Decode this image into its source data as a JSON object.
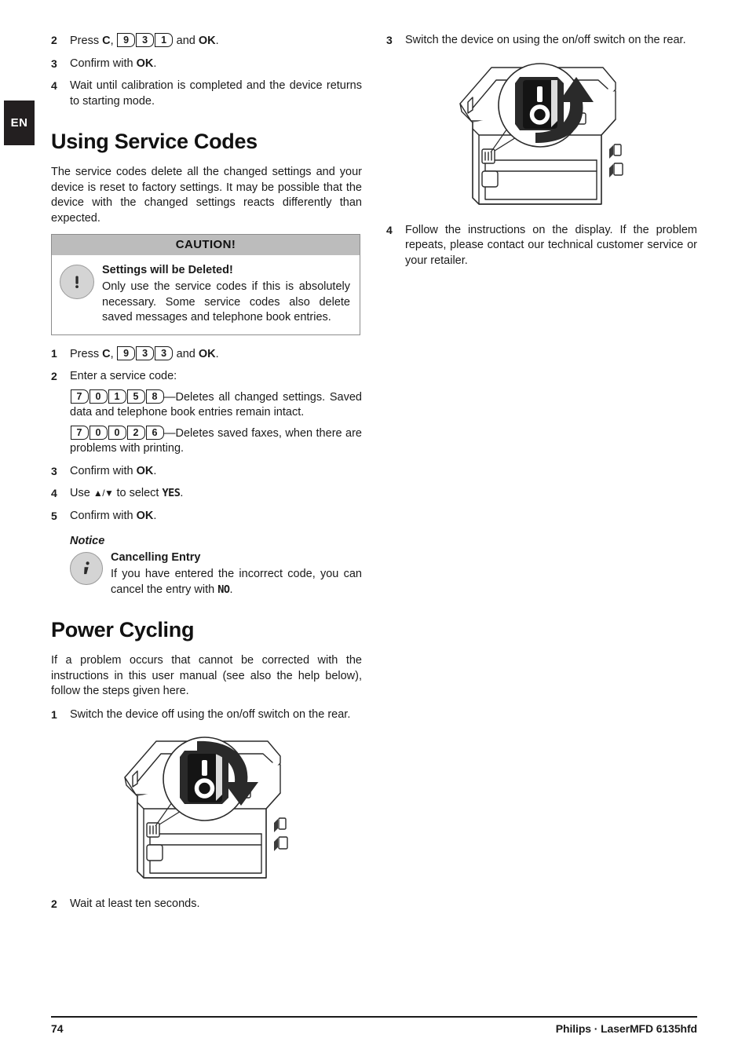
{
  "page": {
    "language_tab": "EN",
    "footer_page_number": "74",
    "footer_model": "Philips · LaserMFD 6135hfd"
  },
  "left_column": {
    "top_steps": [
      {
        "num": "2",
        "prefix": "Press ",
        "bold1": "C",
        "mid": ", ",
        "keys": [
          "9",
          "3",
          "1"
        ],
        "suffix_pre": " and ",
        "bold2": "OK",
        "suffix_post": "."
      },
      {
        "num": "3",
        "text_pre": "Confirm with ",
        "bold": "OK",
        "text_post": "."
      },
      {
        "num": "4",
        "text": "Wait until calibration is completed and the device returns to starting mode."
      }
    ],
    "service_codes": {
      "title": "Using Service Codes",
      "intro": "The service codes delete all the changed settings and your device is reset to factory settings. It may be possible that the device with the changed settings reacts differently than expected.",
      "caution": {
        "header": "CAUTION!",
        "icon": "exclamation-icon",
        "title": "Settings will be Deleted!",
        "text": "Only use the service codes if this is absolutely necessary. Some service codes also delete saved messages and telephone book entries."
      },
      "steps": [
        {
          "num": "1",
          "prefix": "Press ",
          "bold1": "C",
          "mid": ", ",
          "keys": [
            "9",
            "3",
            "3"
          ],
          "suffix_pre": " and ",
          "bold2": "OK",
          "suffix_post": "."
        },
        {
          "num": "2",
          "text": "Enter a service code:"
        },
        {
          "num": "3",
          "text_pre": "Confirm with ",
          "bold": "OK",
          "text_post": "."
        },
        {
          "num": "4",
          "text_pre": "Use ",
          "arrows": "▲/▼",
          "text_mid": " to select ",
          "lcd": "YES",
          "text_post": "."
        },
        {
          "num": "5",
          "text_pre": "Confirm with ",
          "bold": "OK",
          "text_post": "."
        }
      ],
      "code_entries": [
        {
          "keys": [
            "7",
            "0",
            "1",
            "5",
            "8"
          ],
          "description": "—Deletes all changed settings. Saved data and telephone book entries remain intact."
        },
        {
          "keys": [
            "7",
            "0",
            "0",
            "2",
            "6"
          ],
          "description": "—Deletes saved faxes, when there are problems with printing."
        }
      ],
      "notice": {
        "label": "Notice",
        "icon": "info-icon",
        "title": "Cancelling Entry",
        "text_pre": "If you have entered the incorrect code, you can cancel the entry with ",
        "lcd": "NO",
        "text_post": "."
      }
    },
    "power_cycling": {
      "title": "Power Cycling",
      "intro": "If a problem occurs that cannot be corrected with the instructions in this user manual (see also the help below), follow the steps given here.",
      "steps": [
        {
          "num": "1",
          "text": "Switch the device off using the on/off switch on the rear."
        },
        {
          "num": "2",
          "text": "Wait at least ten seconds."
        }
      ],
      "figure": {
        "name": "printer-rear-power-off-illustration",
        "switch_labels": [
          "I",
          "O"
        ],
        "arrow_direction": "down"
      }
    }
  },
  "right_column": {
    "steps": [
      {
        "num": "3",
        "text": "Switch the device on using the on/off switch on the rear."
      },
      {
        "num": "4",
        "text": "Follow the instructions on the display. If the problem repeats, please contact our technical customer service or your retailer."
      }
    ],
    "figure": {
      "name": "printer-rear-power-on-illustration",
      "switch_labels": [
        "I",
        "O"
      ],
      "arrow_direction": "up"
    }
  }
}
